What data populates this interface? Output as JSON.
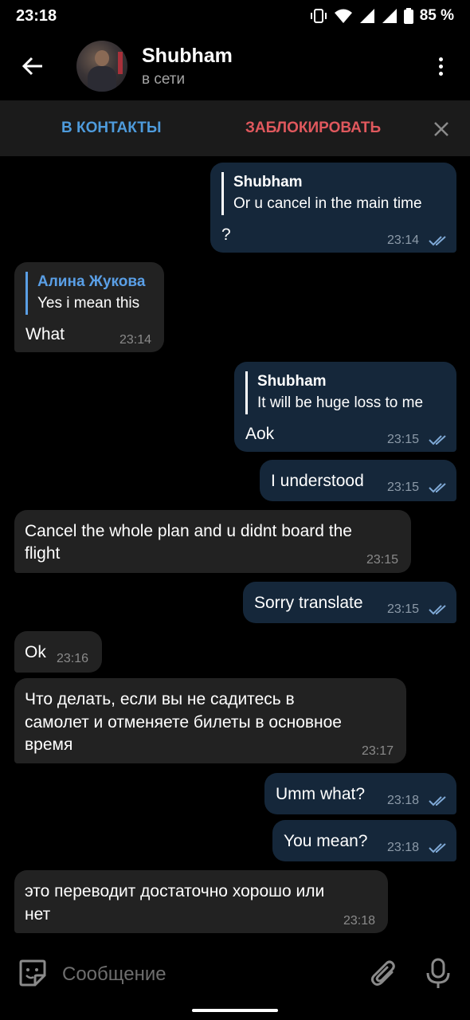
{
  "status_bar": {
    "time": "23:18",
    "battery": "85 %"
  },
  "header": {
    "name": "Shubham",
    "status": "в сети"
  },
  "action_bar": {
    "add_contact": "В КОНТАКТЫ",
    "block": "ЗАБЛОКИРОВАТЬ"
  },
  "messages": [
    {
      "dir": "out",
      "reply_name": "Shubham",
      "reply_text": "Or u cancel in the main time",
      "text": "?",
      "time": "23:14",
      "read": true
    },
    {
      "dir": "in",
      "reply_name": "Алина Жукова",
      "reply_text": "Yes i mean this",
      "text": "What",
      "time": "23:14"
    },
    {
      "dir": "out",
      "reply_name": "Shubham",
      "reply_text": "It will be huge loss to me",
      "text": "Aok",
      "time": "23:15",
      "read": true
    },
    {
      "dir": "out",
      "text": "I understood",
      "time": "23:15",
      "read": true
    },
    {
      "dir": "in",
      "line1": "Cancel the whole plan and u didnt board the",
      "line2": "flight",
      "time": "23:15"
    },
    {
      "dir": "out",
      "text": "Sorry translate",
      "time": "23:15",
      "read": true
    },
    {
      "dir": "in",
      "text": "Ok",
      "time": "23:16"
    },
    {
      "dir": "in",
      "line1": "Что делать, если вы не садитесь в",
      "line2": "самолет и отменяете билеты в основное",
      "line3": "время",
      "time": "23:17"
    },
    {
      "dir": "out",
      "text": "Umm what?",
      "time": "23:18",
      "read": true
    },
    {
      "dir": "out",
      "text": "You mean?",
      "time": "23:18",
      "read": true
    },
    {
      "dir": "in",
      "line1": "это переводит достаточно хорошо или",
      "line2": "нет",
      "time": "23:18"
    }
  ],
  "input": {
    "placeholder": "Сообщение"
  },
  "icons": {
    "back": "arrow-left-icon",
    "menu": "more-vertical-icon",
    "close": "close-icon",
    "emoji": "sticker-emoji-icon",
    "attach": "paperclip-icon",
    "mic": "microphone-icon",
    "read": "double-check-icon"
  },
  "colors": {
    "accent": "#4e9bdc",
    "danger": "#e0585d",
    "outgoing_bubble": "#15273a",
    "incoming_bubble": "#222222"
  }
}
